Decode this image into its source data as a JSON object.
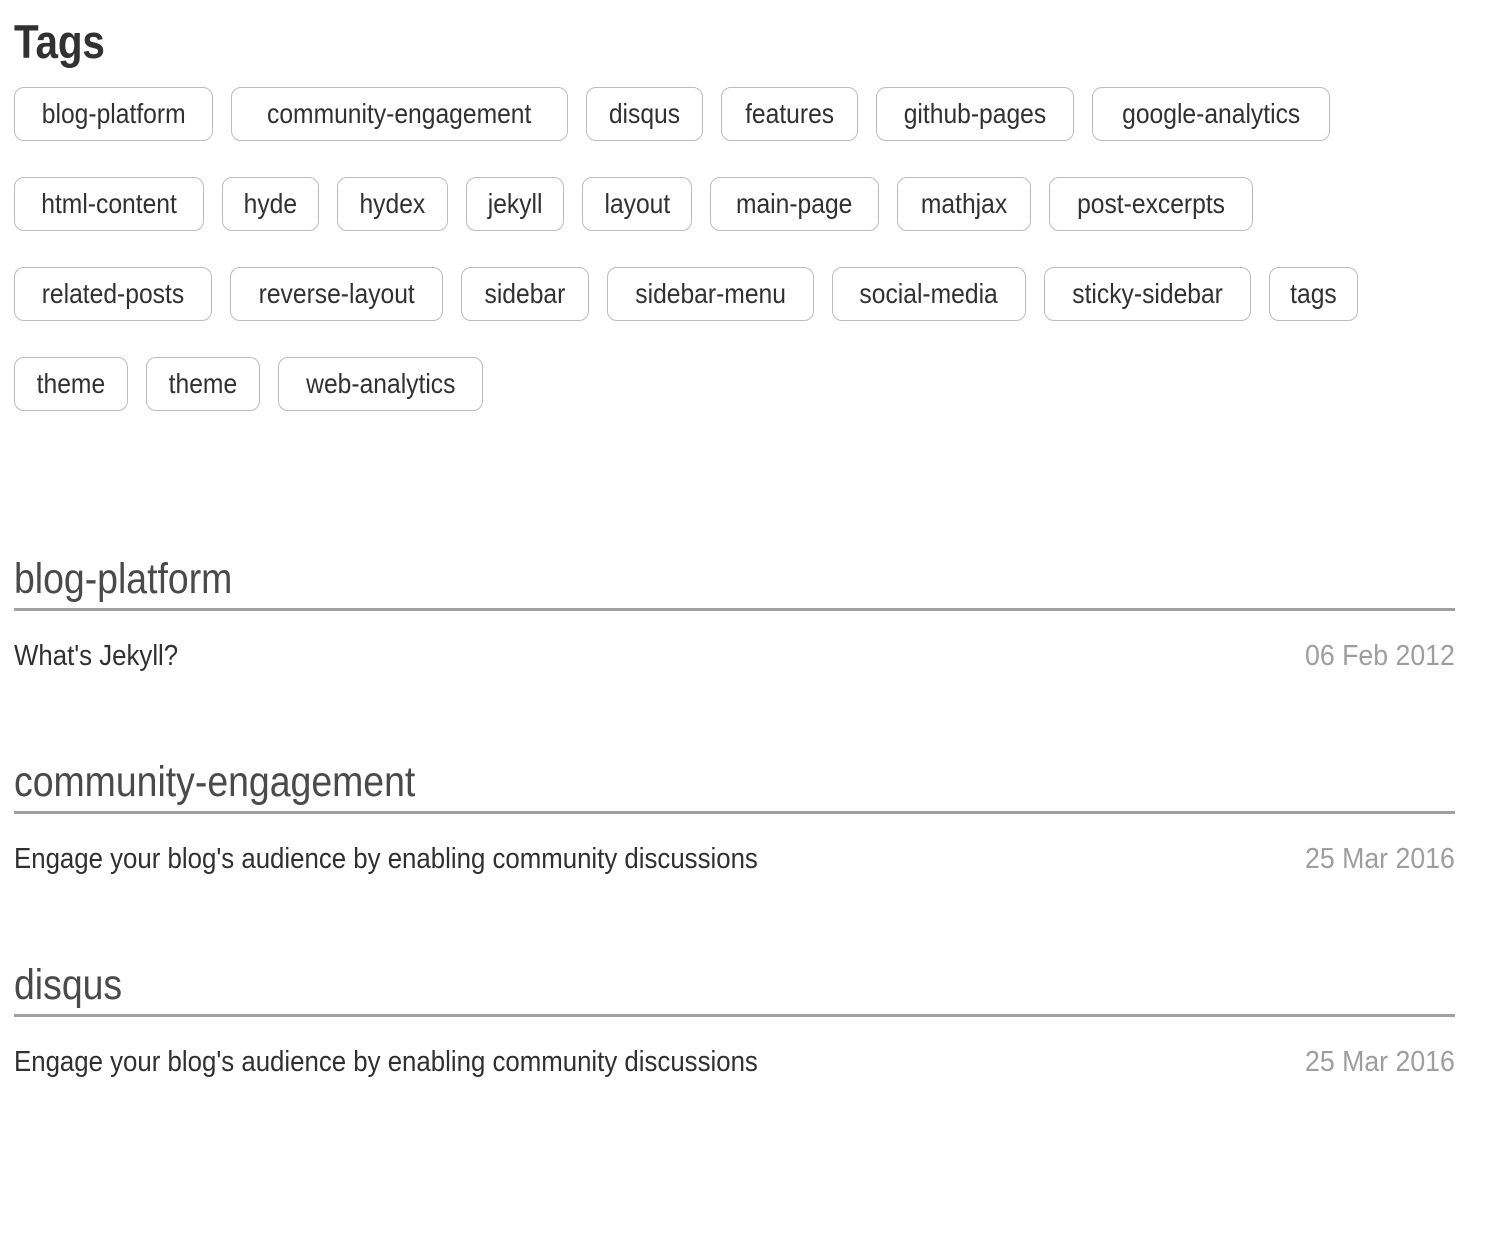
{
  "page": {
    "title": "Tags"
  },
  "tag_cloud": [
    {
      "label": "blog-platform"
    },
    {
      "label": "community-engagement"
    },
    {
      "label": "disqus"
    },
    {
      "label": "features"
    },
    {
      "label": "github-pages"
    },
    {
      "label": "google-analytics"
    },
    {
      "label": "html-content"
    },
    {
      "label": "hyde"
    },
    {
      "label": "hydex"
    },
    {
      "label": "jekyll"
    },
    {
      "label": "layout"
    },
    {
      "label": "main-page"
    },
    {
      "label": "mathjax"
    },
    {
      "label": "post-excerpts"
    },
    {
      "label": "related-posts"
    },
    {
      "label": "reverse-layout"
    },
    {
      "label": "sidebar"
    },
    {
      "label": "sidebar-menu"
    },
    {
      "label": "social-media"
    },
    {
      "label": "sticky-sidebar"
    },
    {
      "label": "tags"
    },
    {
      "label": "theme"
    },
    {
      "label": "theme"
    },
    {
      "label": "web-analytics"
    }
  ],
  "sections": [
    {
      "heading": "blog-platform",
      "posts": [
        {
          "title": "What's Jekyll?",
          "date": "06 Feb 2012"
        }
      ]
    },
    {
      "heading": "community-engagement",
      "posts": [
        {
          "title": "Engage your blog's audience by enabling community discussions",
          "date": "25 Mar 2016"
        }
      ]
    },
    {
      "heading": "disqus",
      "posts": [
        {
          "title": "Engage your blog's audience by enabling community discussions",
          "date": "25 Mar 2016"
        }
      ]
    }
  ],
  "colors": {
    "text": "#313131",
    "heading": "#4a4a4a",
    "muted": "#9e9e9e",
    "rule": "#a0a0a0",
    "pill_border": "#bdbdbd",
    "background": "#ffffff"
  }
}
